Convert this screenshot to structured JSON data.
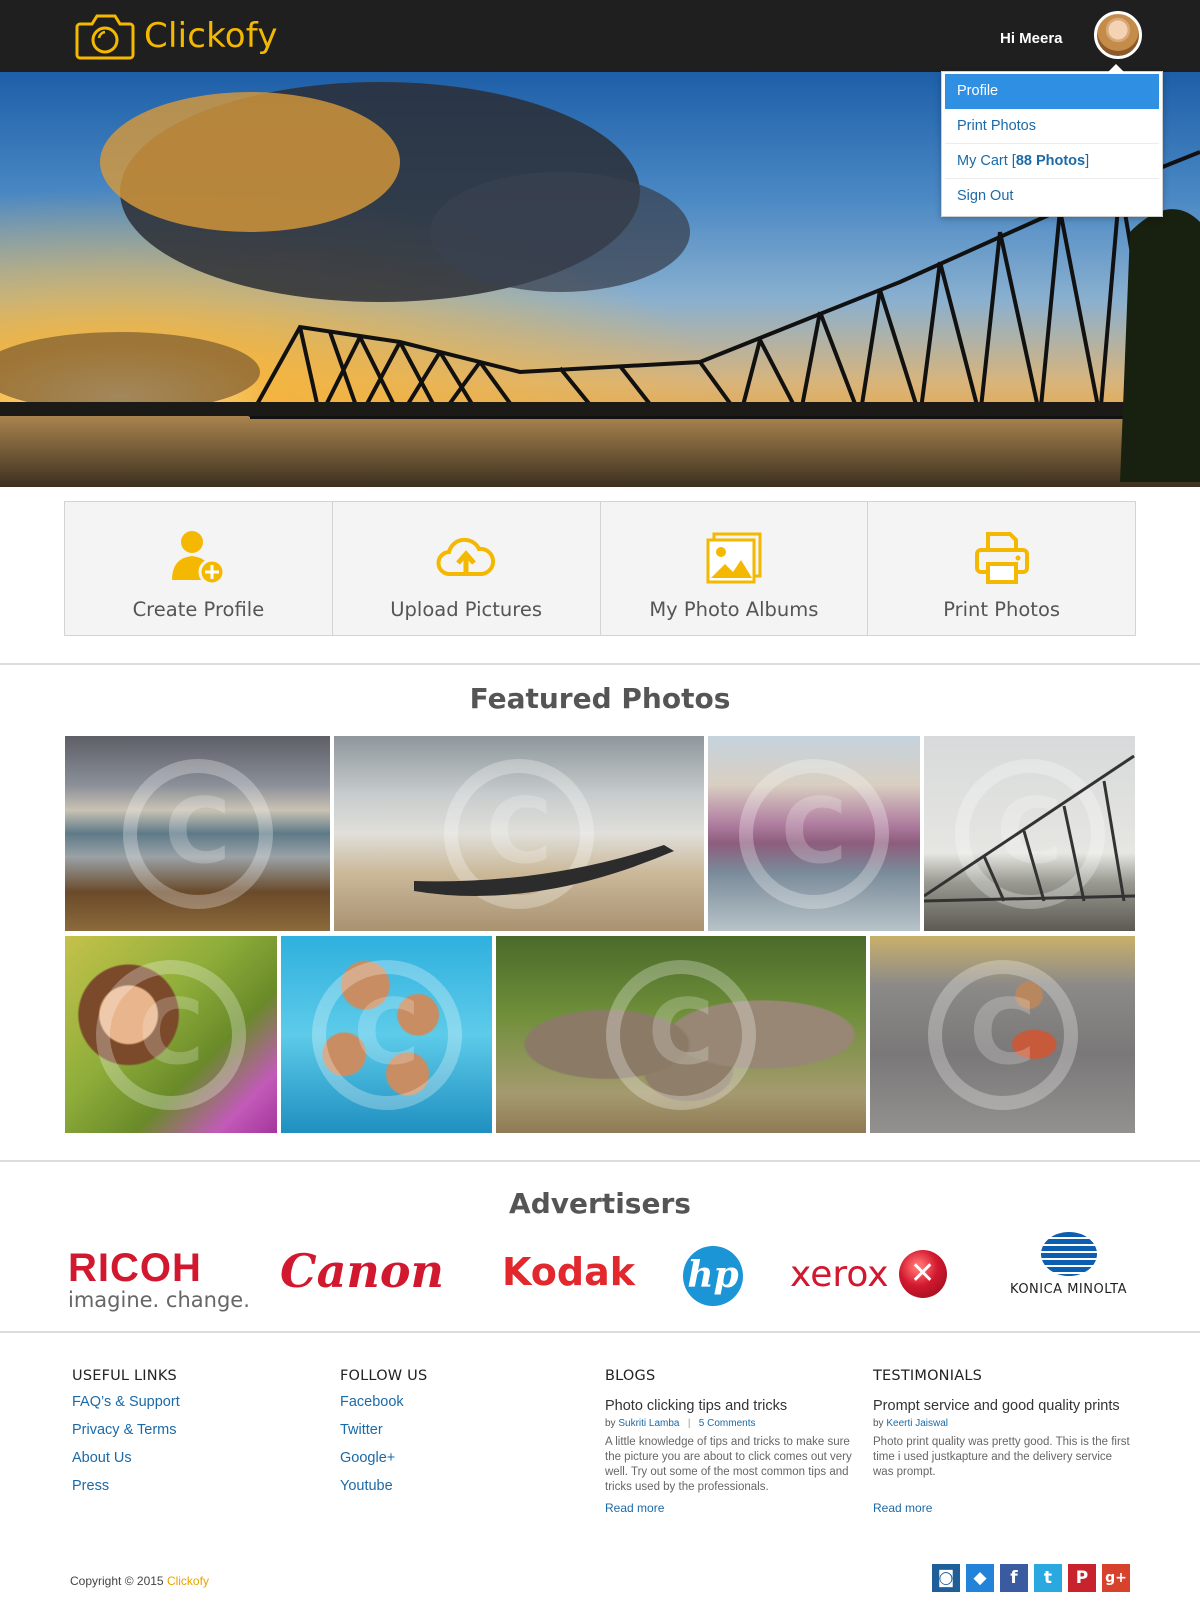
{
  "header": {
    "brand": "Clickofy",
    "greeting": "Hi Meera"
  },
  "menu": {
    "items": [
      {
        "label": "Profile"
      },
      {
        "label": "Print Photos"
      },
      {
        "label_prefix": "My Cart [",
        "label_bold": "88 Photos",
        "label_suffix": "]"
      },
      {
        "label": "Sign Out"
      }
    ]
  },
  "features": [
    {
      "label": "Create Profile",
      "icon": "add-user-icon"
    },
    {
      "label": "Upload Pictures",
      "icon": "cloud-upload-icon"
    },
    {
      "label": "My Photo Albums",
      "icon": "photo-album-icon"
    },
    {
      "label": "Print Photos",
      "icon": "printer-icon"
    }
  ],
  "featured": {
    "title": "Featured Photos",
    "photos": [
      "mountain-lake",
      "beach-boat",
      "riverside-temples",
      "bridge-birds",
      "girl-flowers",
      "kids-pool",
      "elephants",
      "man-pigeons"
    ]
  },
  "advertisers": {
    "title": "Advertisers",
    "ricoh_name": "RICOH",
    "ricoh_tag": "imagine. change.",
    "canon": "Canon",
    "kodak": "Kodak",
    "hp": "hp",
    "xerox": "xerox",
    "konica": "KONICA MINOLTA"
  },
  "footer": {
    "useful_links": {
      "heading": "USEFUL LINKS",
      "links": [
        "FAQ’s & Support",
        "Privacy & Terms",
        "About Us",
        "Press"
      ]
    },
    "follow_us": {
      "heading": "FOLLOW US",
      "links": [
        "Facebook",
        "Twitter",
        "Google+",
        "Youtube"
      ]
    },
    "blogs": {
      "heading": "BLOGS",
      "title": "Photo clicking tips and tricks",
      "by": "by",
      "author": "Sukriti Lamba",
      "sep": "|",
      "comments": "5 Comments",
      "body": "A little knowledge of tips and tricks to make sure the picture you are about to click comes out very well. Try out some of the most common tips and tricks used by the professionals.",
      "more": "Read more"
    },
    "testimonials": {
      "heading": "TESTIMONIALS",
      "title": "Prompt service and good quality prints",
      "by": "by",
      "author": "Keerti Jaiswal",
      "body": "Photo print quality was pretty good. This is the first time i used justkapture and the delivery service was prompt.",
      "more": "Read more"
    },
    "copyright_prefix": "Copyright",
    "copyright_symbol": "©",
    "copyright_year": "2015",
    "copyright_brand": "Clickofy",
    "social": [
      {
        "name": "instagram-icon",
        "glyph": "◙",
        "color": "#1f5f99"
      },
      {
        "name": "dropbox-icon",
        "glyph": "◆",
        "color": "#2383d8"
      },
      {
        "name": "facebook-icon",
        "glyph": "f",
        "color": "#3b5ba0"
      },
      {
        "name": "twitter-icon",
        "glyph": "t",
        "color": "#2aa9e0"
      },
      {
        "name": "pinterest-icon",
        "glyph": "P",
        "color": "#c8232c"
      },
      {
        "name": "google-plus-icon",
        "glyph": "g+",
        "color": "#d6422c"
      }
    ]
  }
}
